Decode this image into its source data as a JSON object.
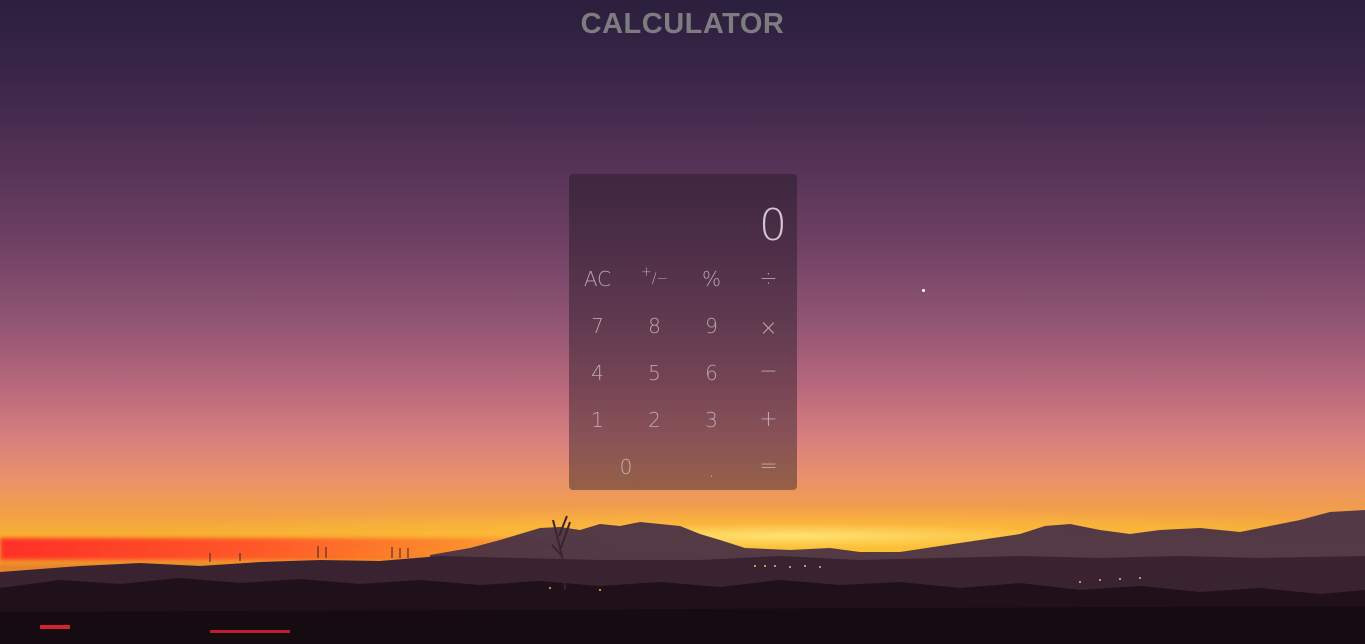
{
  "page": {
    "title": "CALCULATOR"
  },
  "calculator": {
    "display": "0",
    "keys": {
      "ac": "AC",
      "plus_minus_top": "+",
      "plus_minus_bottom": "/−",
      "percent": "%",
      "divide": "÷",
      "seven": "7",
      "eight": "8",
      "nine": "9",
      "multiply": "×",
      "four": "4",
      "five": "5",
      "six": "6",
      "minus": "−",
      "one": "1",
      "two": "2",
      "three": "3",
      "plus": "+",
      "zero": "0",
      "decimal": ".",
      "equals": "="
    }
  },
  "colors": {
    "sky_top": "#2b1f3d",
    "sky_mid": "#b8687c",
    "horizon": "#f8c629",
    "calculator_bg": "rgba(28,22,30,0.42)"
  },
  "icons": {
    "moon": "crescent-moon-icon"
  }
}
